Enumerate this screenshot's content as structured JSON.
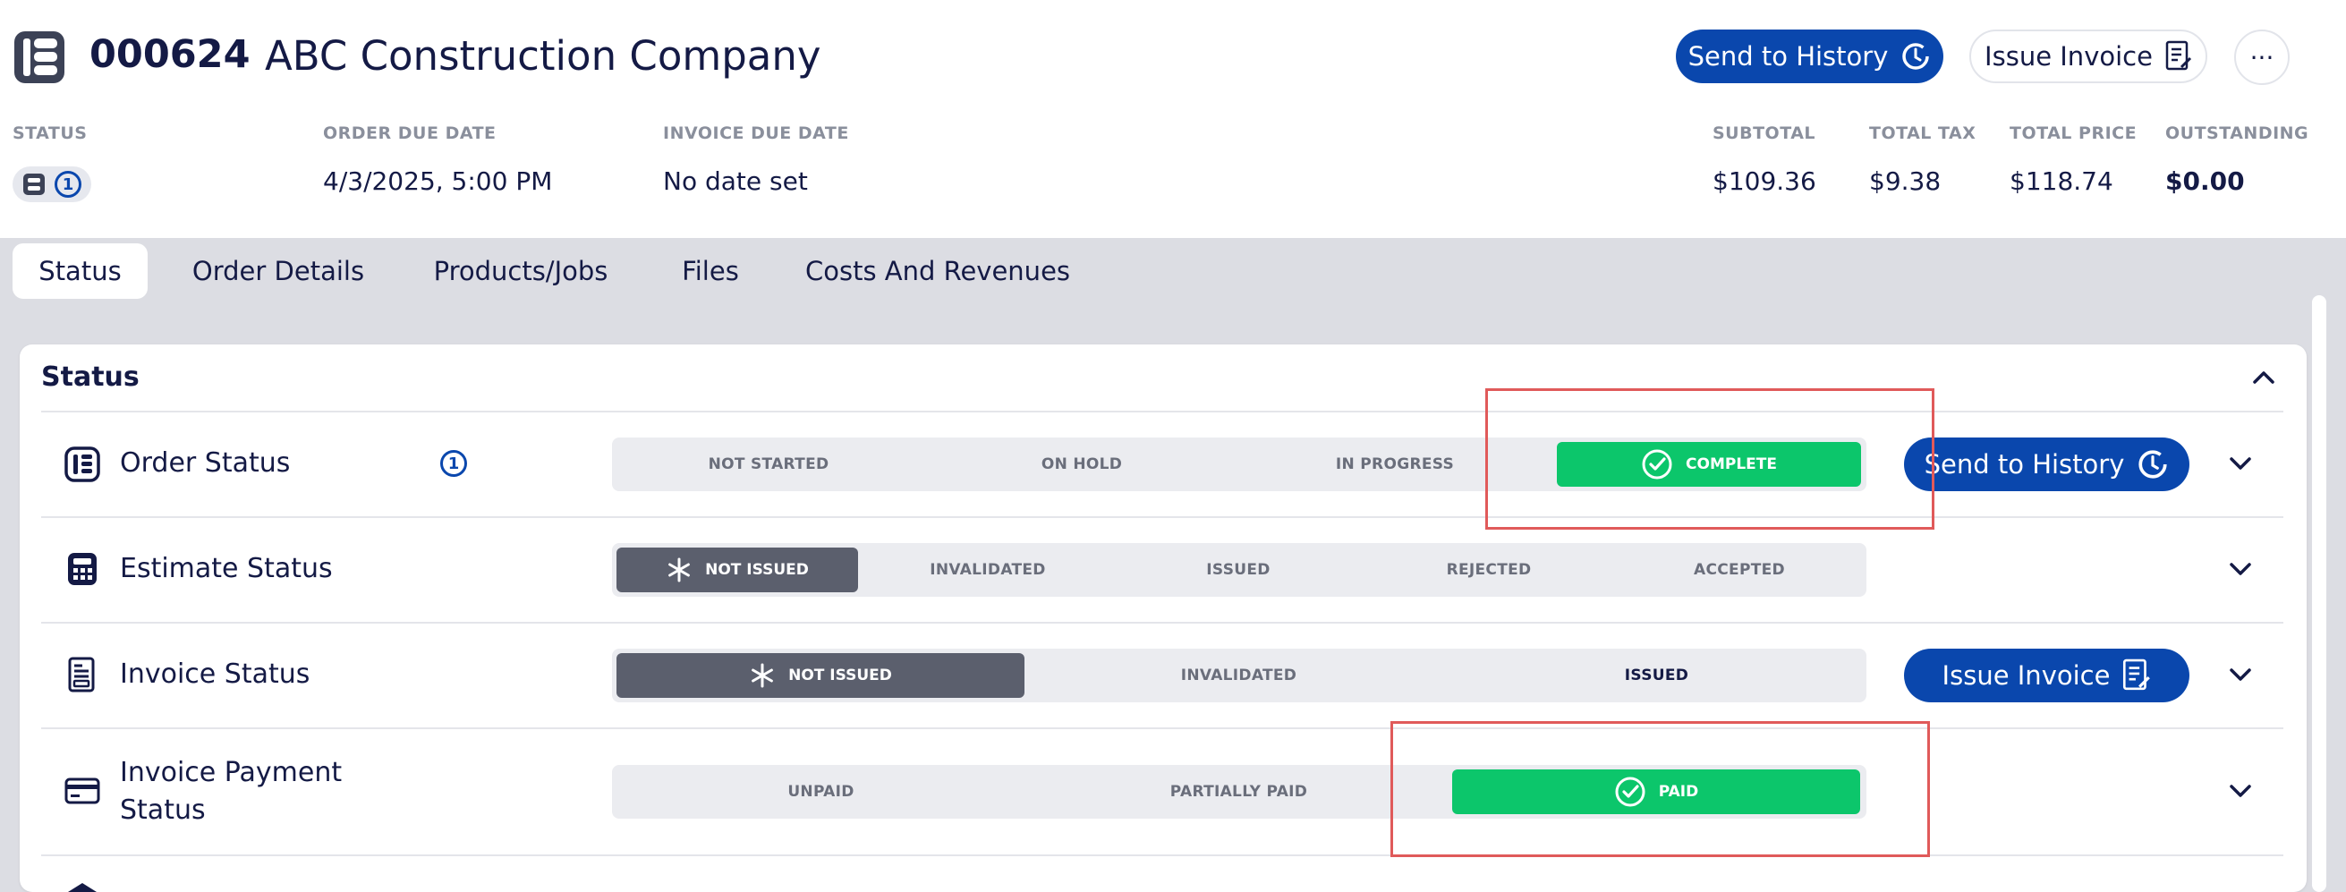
{
  "header": {
    "order_number": "000624",
    "company_name": "ABC Construction Company",
    "send_to_history_label": "Send to History",
    "issue_invoice_label": "Issue Invoice",
    "more_label": "···"
  },
  "meta": {
    "status_label": "STATUS",
    "status_count": "1",
    "order_due_label": "ORDER DUE DATE",
    "order_due_value": "4/3/2025, 5:00 PM",
    "invoice_due_label": "INVOICE DUE DATE",
    "invoice_due_value": "No date set",
    "subtotal_label": "SUBTOTAL",
    "subtotal_value": "$109.36",
    "total_tax_label": "TOTAL TAX",
    "total_tax_value": "$9.38",
    "total_price_label": "TOTAL PRICE",
    "total_price_value": "$118.74",
    "outstanding_label": "OUTSTANDING",
    "outstanding_value": "$0.00"
  },
  "tabs": [
    {
      "label": "Status"
    },
    {
      "label": "Order Details"
    },
    {
      "label": "Products/Jobs"
    },
    {
      "label": "Files"
    },
    {
      "label": "Costs And Revenues"
    }
  ],
  "card": {
    "title": "Status"
  },
  "rows": {
    "order": {
      "label": "Order Status",
      "count": "1",
      "steps": [
        "NOT STARTED",
        "ON HOLD",
        "IN PROGRESS",
        "COMPLETE"
      ],
      "action_label": "Send to History"
    },
    "estimate": {
      "label": "Estimate Status",
      "steps": [
        "NOT ISSUED",
        "INVALIDATED",
        "ISSUED",
        "REJECTED",
        "ACCEPTED"
      ]
    },
    "invoice": {
      "label": "Invoice Status",
      "steps": [
        "NOT ISSUED",
        "INVALIDATED",
        "ISSUED"
      ],
      "action_label": "Issue Invoice"
    },
    "payment": {
      "label_line1": "Invoice Payment",
      "label_line2": "Status",
      "steps": [
        "UNPAID",
        "PARTIALLY PAID",
        "PAID"
      ]
    }
  },
  "colors": {
    "primary": "#0a47ad",
    "success": "#0cc66b",
    "neutral_dark": "#5b5f6d",
    "highlight": "#e05a5a"
  }
}
